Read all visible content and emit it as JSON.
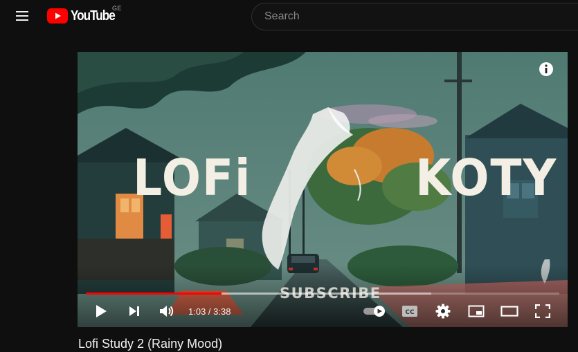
{
  "masthead": {
    "menu_icon": "hamburger-menu-icon",
    "logo_icon": "youtube-play-icon",
    "logo_text": "YouTube",
    "country_code": "GE",
    "search_placeholder": "Search",
    "colors": {
      "brand_red": "#ff0000",
      "background": "#0f0f0f"
    }
  },
  "player": {
    "thumbnail_text": {
      "left_word": "LOFi",
      "right_word": "KOTY",
      "subscribe": "SUBSCRIBE"
    },
    "info_icon": "info-icon",
    "progress": {
      "played_fraction": 0.287,
      "loaded_fraction": 0.73,
      "played_color": "#ff0000"
    },
    "time": {
      "current": "1:03",
      "separator": " / ",
      "duration": "3:38"
    },
    "controls": {
      "play_icon": "play-icon",
      "next_icon": "skip-next-icon",
      "volume_icon": "volume-icon",
      "autoplay_icon": "autoplay-toggle-icon",
      "captions_label": "CC",
      "settings_icon": "gear-icon",
      "miniplayer_icon": "miniplayer-icon",
      "theater_icon": "theater-mode-icon",
      "fullscreen_icon": "fullscreen-icon"
    }
  },
  "video": {
    "title": "Lofi Study 2 (Rainy Mood)"
  }
}
